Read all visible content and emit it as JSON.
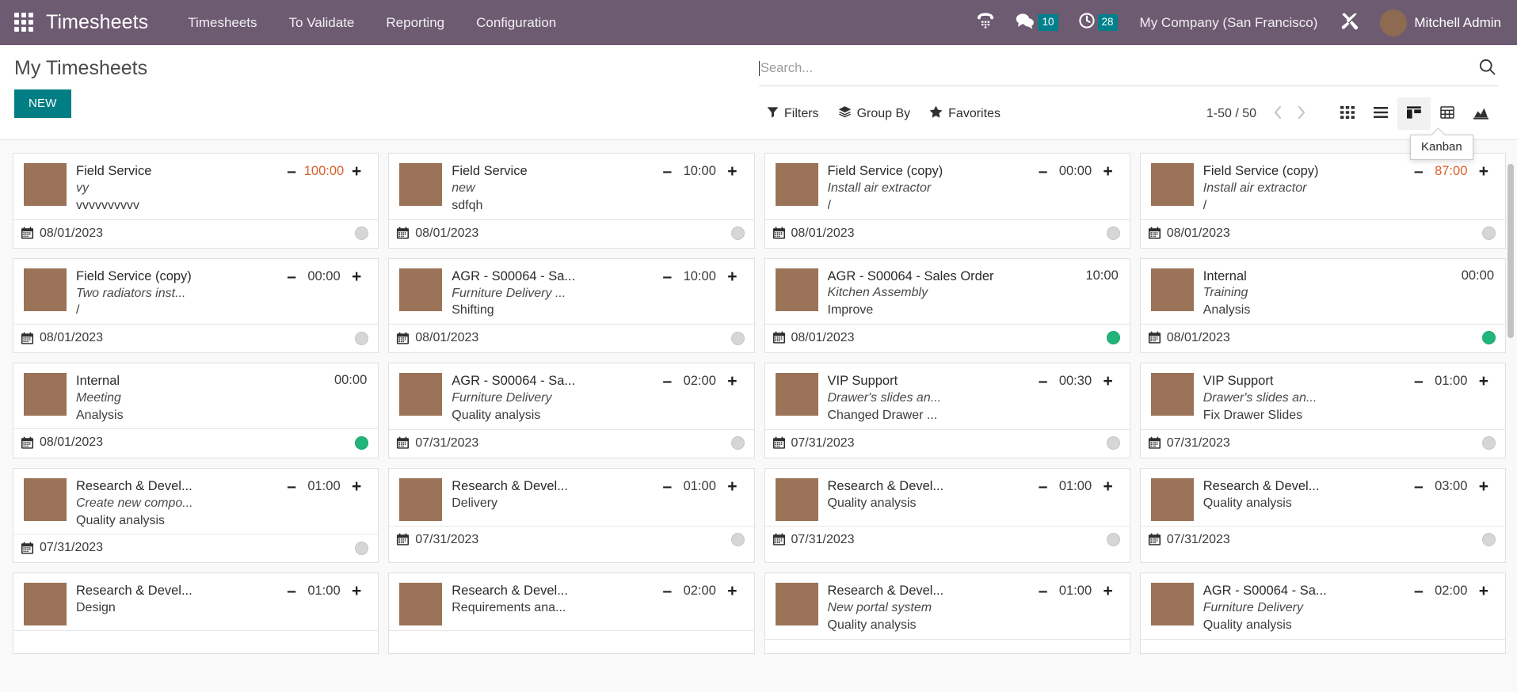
{
  "navbar": {
    "apps_icon": "apps-grid-icon",
    "brand": "Timesheets",
    "menu": [
      {
        "label": "Timesheets"
      },
      {
        "label": "To Validate"
      },
      {
        "label": "Reporting"
      },
      {
        "label": "Configuration"
      }
    ],
    "phone_icon": "phone-dialpad-icon",
    "messages_icon": "chat-bubble-icon",
    "messages_count": "10",
    "activities_icon": "clock-icon",
    "activities_count": "28",
    "company": "My Company (San Francisco)",
    "debug_icon": "tools-wrench-icon",
    "user_name": "Mitchell Admin",
    "badge_color": "#00808c",
    "bar_color": "#6d5b72"
  },
  "control_panel": {
    "title": "My Timesheets",
    "new_button": "NEW",
    "new_button_color": "#017e84",
    "search": {
      "value": "",
      "placeholder": "Search..."
    },
    "search_icon": "magnifier-icon",
    "tools": [
      {
        "label": "Filters",
        "icon": "funnel-icon"
      },
      {
        "label": "Group By",
        "icon": "layers-icon"
      },
      {
        "label": "Favorites",
        "icon": "star-icon"
      }
    ],
    "pager": {
      "count": "1-50 / 50",
      "prev_icon": "chevron-left-icon",
      "next_icon": "chevron-right-icon"
    },
    "views": [
      {
        "name": "kanban-grid",
        "icon": "grid-dots-icon",
        "active": false
      },
      {
        "name": "list",
        "icon": "list-lines-icon",
        "active": false
      },
      {
        "name": "kanban",
        "icon": "kanban-columns-icon",
        "active": true
      },
      {
        "name": "pivot",
        "icon": "table-grid-icon",
        "active": false
      },
      {
        "name": "graph",
        "icon": "area-chart-icon",
        "active": false
      }
    ],
    "tooltip": "Kanban"
  },
  "kanban": {
    "accent_hot": "#d9602a",
    "status_green": "#21b57b",
    "status_grey": "#d6d6d6",
    "cards": [
      {
        "project": "Field Service",
        "task": "vy",
        "desc": "vvvvvvvvvv",
        "time": "100:00",
        "hot": true,
        "stepper": true,
        "date": "08/01/2023",
        "status": "grey"
      },
      {
        "project": "Field Service",
        "task": "new",
        "desc": "sdfqh",
        "time": "10:00",
        "hot": false,
        "stepper": true,
        "date": "08/01/2023",
        "status": "grey"
      },
      {
        "project": "Field Service (copy)",
        "task": "Install air extractor",
        "desc": "/",
        "time": "00:00",
        "hot": false,
        "stepper": true,
        "date": "08/01/2023",
        "status": "grey"
      },
      {
        "project": "Field Service (copy)",
        "task": "Install air extractor",
        "desc": "/",
        "time": "87:00",
        "hot": true,
        "stepper": true,
        "date": "08/01/2023",
        "status": "grey"
      },
      {
        "project": "Field Service (copy)",
        "task": "Two radiators inst...",
        "desc": "/",
        "time": "00:00",
        "hot": false,
        "stepper": true,
        "date": "08/01/2023",
        "status": "grey"
      },
      {
        "project": "AGR - S00064 - Sa...",
        "task": "Furniture Delivery ...",
        "desc": "Shifting",
        "time": "10:00",
        "hot": false,
        "stepper": true,
        "date": "08/01/2023",
        "status": "grey"
      },
      {
        "project": "AGR - S00064 - Sales Order",
        "task": "Kitchen Assembly",
        "desc": "Improve",
        "time": "10:00",
        "hot": false,
        "stepper": false,
        "date": "08/01/2023",
        "status": "green"
      },
      {
        "project": "Internal",
        "task": "Training",
        "desc": "Analysis",
        "time": "00:00",
        "hot": false,
        "stepper": false,
        "date": "08/01/2023",
        "status": "green"
      },
      {
        "project": "Internal",
        "task": "Meeting",
        "desc": "Analysis",
        "time": "00:00",
        "hot": false,
        "stepper": false,
        "date": "08/01/2023",
        "status": "green"
      },
      {
        "project": "AGR - S00064 - Sa...",
        "task": "Furniture Delivery",
        "desc": "Quality analysis",
        "time": "02:00",
        "hot": false,
        "stepper": true,
        "date": "07/31/2023",
        "status": "grey"
      },
      {
        "project": "VIP Support",
        "task": "Drawer's slides an...",
        "desc": "Changed Drawer ...",
        "time": "00:30",
        "hot": false,
        "stepper": true,
        "date": "07/31/2023",
        "status": "grey"
      },
      {
        "project": "VIP Support",
        "task": "Drawer's slides an...",
        "desc": "Fix Drawer Slides",
        "time": "01:00",
        "hot": false,
        "stepper": true,
        "date": "07/31/2023",
        "status": "grey"
      },
      {
        "project": "Research & Devel...",
        "task": "Create new compo...",
        "desc": "Quality analysis",
        "time": "01:00",
        "hot": false,
        "stepper": true,
        "date": "07/31/2023",
        "status": "grey"
      },
      {
        "project": "Research & Devel...",
        "task": "",
        "desc": "Delivery",
        "time": "01:00",
        "hot": false,
        "stepper": true,
        "date": "07/31/2023",
        "status": "grey"
      },
      {
        "project": "Research & Devel...",
        "task": "",
        "desc": "Quality analysis",
        "time": "01:00",
        "hot": false,
        "stepper": true,
        "date": "07/31/2023",
        "status": "grey"
      },
      {
        "project": "Research & Devel...",
        "task": "",
        "desc": "Quality analysis",
        "time": "03:00",
        "hot": false,
        "stepper": true,
        "date": "07/31/2023",
        "status": "grey"
      },
      {
        "project": "Research & Devel...",
        "task": "",
        "desc": "Design",
        "time": "01:00",
        "hot": false,
        "stepper": true,
        "date": "",
        "status": "grey"
      },
      {
        "project": "Research & Devel...",
        "task": "",
        "desc": "Requirements ana...",
        "time": "02:00",
        "hot": false,
        "stepper": true,
        "date": "",
        "status": "grey"
      },
      {
        "project": "Research & Devel...",
        "task": "New portal system",
        "desc": "Quality analysis",
        "time": "01:00",
        "hot": false,
        "stepper": true,
        "date": "",
        "status": "grey"
      },
      {
        "project": "AGR - S00064 - Sa...",
        "task": "Furniture Delivery",
        "desc": "Quality analysis",
        "time": "02:00",
        "hot": false,
        "stepper": true,
        "date": "",
        "status": "grey"
      }
    ],
    "stepper_minus": "–",
    "stepper_plus": "+"
  }
}
